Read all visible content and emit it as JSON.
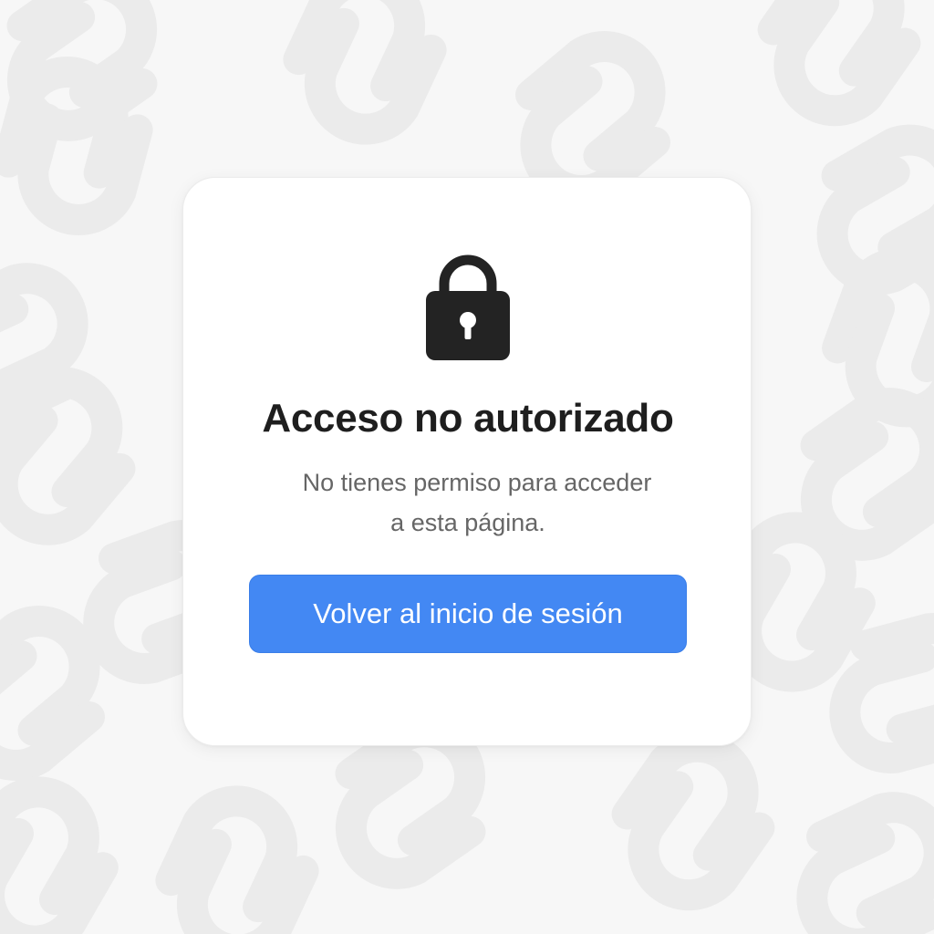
{
  "background": {
    "pattern_icon": "chain-link-icon",
    "color": "#f7f7f7"
  },
  "dialog": {
    "icon": "lock-icon",
    "title": "Acceso no autorizado",
    "message_line_1": "No tienes permiso para acceder",
    "message_line_2": "a esta página.",
    "button_label": "Volver al inicio de sesión"
  },
  "colors": {
    "accent": "#4388f3",
    "title": "#1e1e1e",
    "text": "#666666",
    "icon": "#232323"
  }
}
